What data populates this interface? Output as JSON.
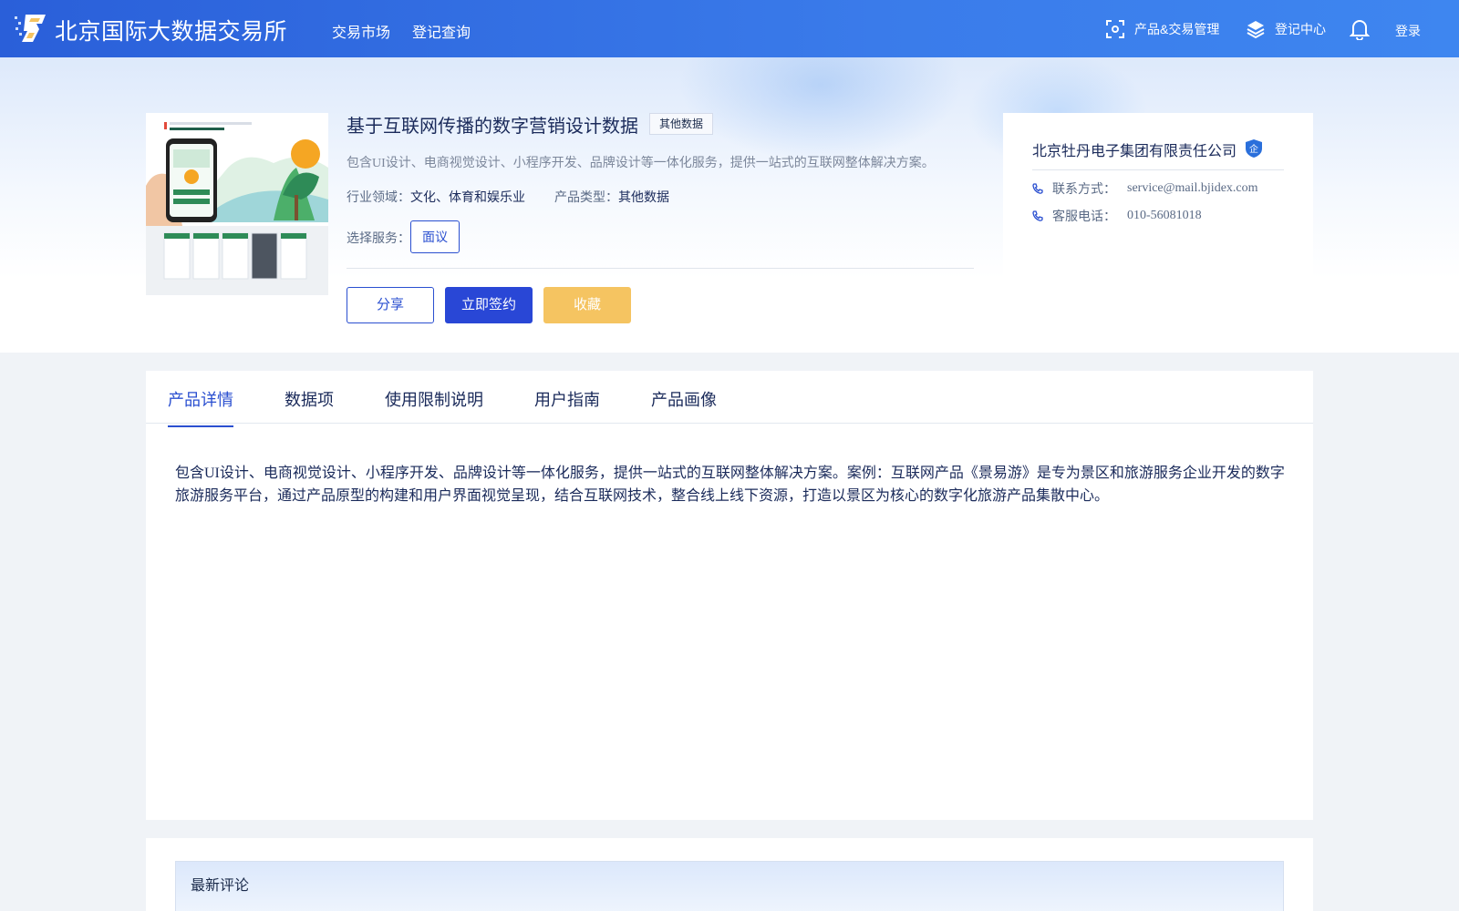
{
  "header": {
    "site_title": "北京国际大数据交易所",
    "nav": [
      "交易市场",
      "登记查询"
    ],
    "product_mgmt": "产品&交易管理",
    "registry_center": "登记中心",
    "login": "登录"
  },
  "product": {
    "title": "基于互联网传播的数字营销设计数据",
    "type_tag": "其他数据",
    "description": "包含UI设计、电商视觉设计、小程序开发、品牌设计等一体化服务，提供一站式的互联网整体解决方案。",
    "industry_label": "行业领域：",
    "industry_value": "文化、体育和娱乐业",
    "type_label": "产品类型：",
    "type_value": "其他数据",
    "service_label": "选择服务：",
    "service_option": "面议",
    "share": "分享",
    "sign": "立即签约",
    "favorite": "收藏"
  },
  "company": {
    "name": "北京牡丹电子集团有限责任公司",
    "badge": "企",
    "contact_label": "联系方式：",
    "contact_value": "service@mail.bjidex.com",
    "phone_label": "客服电话：",
    "phone_value": "010-56081018"
  },
  "tabs": [
    "产品详情",
    "数据项",
    "使用限制说明",
    "用户指南",
    "产品画像"
  ],
  "active_tab": "产品详情",
  "detail_text": "包含UI设计、电商视觉设计、小程序开发、品牌设计等一体化服务，提供一站式的互联网整体解决方案。案例：互联网产品《景易游》是专为景区和旅游服务企业开发的数字旅游服务平台，通过产品原型的构建和用户界面视觉呈现，结合互联网技术，整合线上线下资源，打造以景区为核心的数字化旅游产品集散中心。",
  "comments": {
    "title": "最新评论"
  },
  "colors": {
    "header_blue": "#2a5fd9",
    "primary": "#2947d6",
    "favorite": "#f5c461"
  }
}
